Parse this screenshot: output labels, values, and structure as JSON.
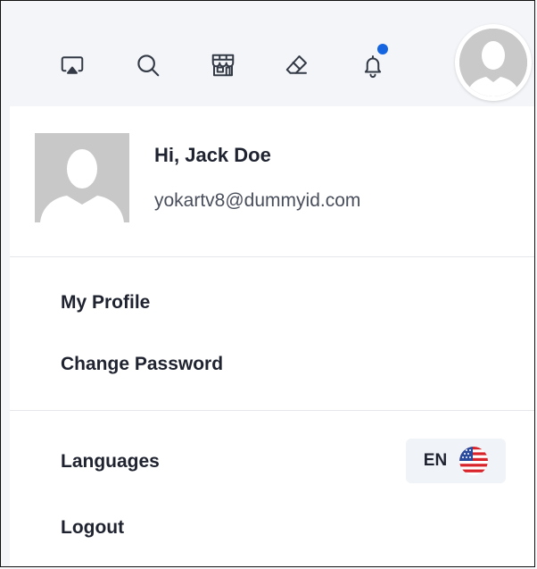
{
  "topbar": {
    "icons": [
      "cast-icon",
      "search-icon",
      "storefront-icon",
      "eraser-icon",
      "bell-icon"
    ],
    "notification_dot_color": "#1565e0"
  },
  "user": {
    "greeting": "Hi, Jack Doe",
    "email": "yokartv8@dummyid.com"
  },
  "menu": {
    "my_profile": "My Profile",
    "change_password": "Change Password",
    "languages": "Languages",
    "language_code": "EN",
    "language_flag": "us-flag-icon",
    "logout": "Logout"
  }
}
